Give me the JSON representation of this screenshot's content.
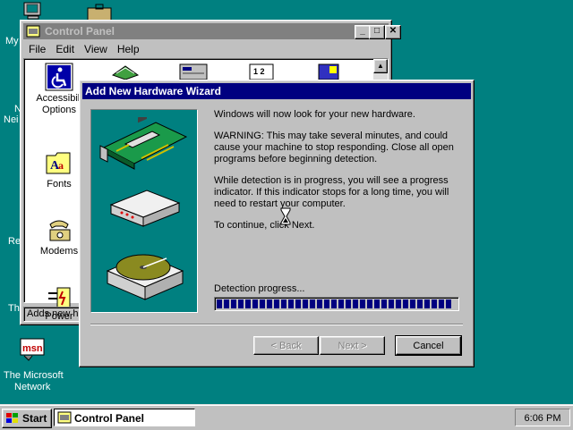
{
  "desktop": {
    "icons": [
      {
        "label_lines": [
          "My"
        ]
      },
      {
        "label_lines": [
          "N",
          "Nei"
        ]
      },
      {
        "label_lines": [
          "Re"
        ]
      },
      {
        "label_lines": [
          "Th"
        ]
      },
      {
        "label_lines": [
          "The Microsoft",
          "Network"
        ]
      }
    ]
  },
  "control_panel": {
    "title": "Control Panel",
    "buttons": {
      "minimize": "_",
      "maximize": "□",
      "close": "✕"
    },
    "menu": [
      "File",
      "Edit",
      "View",
      "Help"
    ],
    "items": [
      {
        "label_lines": [
          "Accessibili",
          "Options"
        ],
        "icon": "accessibility-icon"
      },
      {
        "label_lines": [
          "Fonts"
        ],
        "icon": "fonts-folder-icon"
      },
      {
        "label_lines": [
          "Modems"
        ],
        "icon": "modem-phone-icon"
      },
      {
        "label_lines": [
          "Power"
        ],
        "icon": "power-plug-icon"
      }
    ],
    "status": "Adds new ha"
  },
  "wizard": {
    "title": "Add New Hardware Wizard",
    "paragraphs": [
      "Windows will now look for your new hardware.",
      "WARNING: This may take several minutes, and could cause your machine to stop responding. Close all open programs before beginning detection.",
      "While detection is in progress, you will see a progress indicator. If this indicator stops for a long time, you will need to restart your computer.",
      "To continue, click Next."
    ],
    "progress_label": "Detection progress...",
    "progress_fraction": 1.0,
    "buttons": {
      "back": "< Back",
      "next": "Next >",
      "cancel": "Cancel"
    },
    "illustration_icons": [
      "expansion-card-icon",
      "modem-box-icon",
      "disk-drive-icon"
    ]
  },
  "taskbar": {
    "start_label": "Start",
    "task_label": "Control Panel",
    "clock": "6:06 PM"
  },
  "colors": {
    "desktop": "#008080",
    "active_title": "#000080",
    "inactive_title": "#808080",
    "face": "#c0c0c0"
  }
}
